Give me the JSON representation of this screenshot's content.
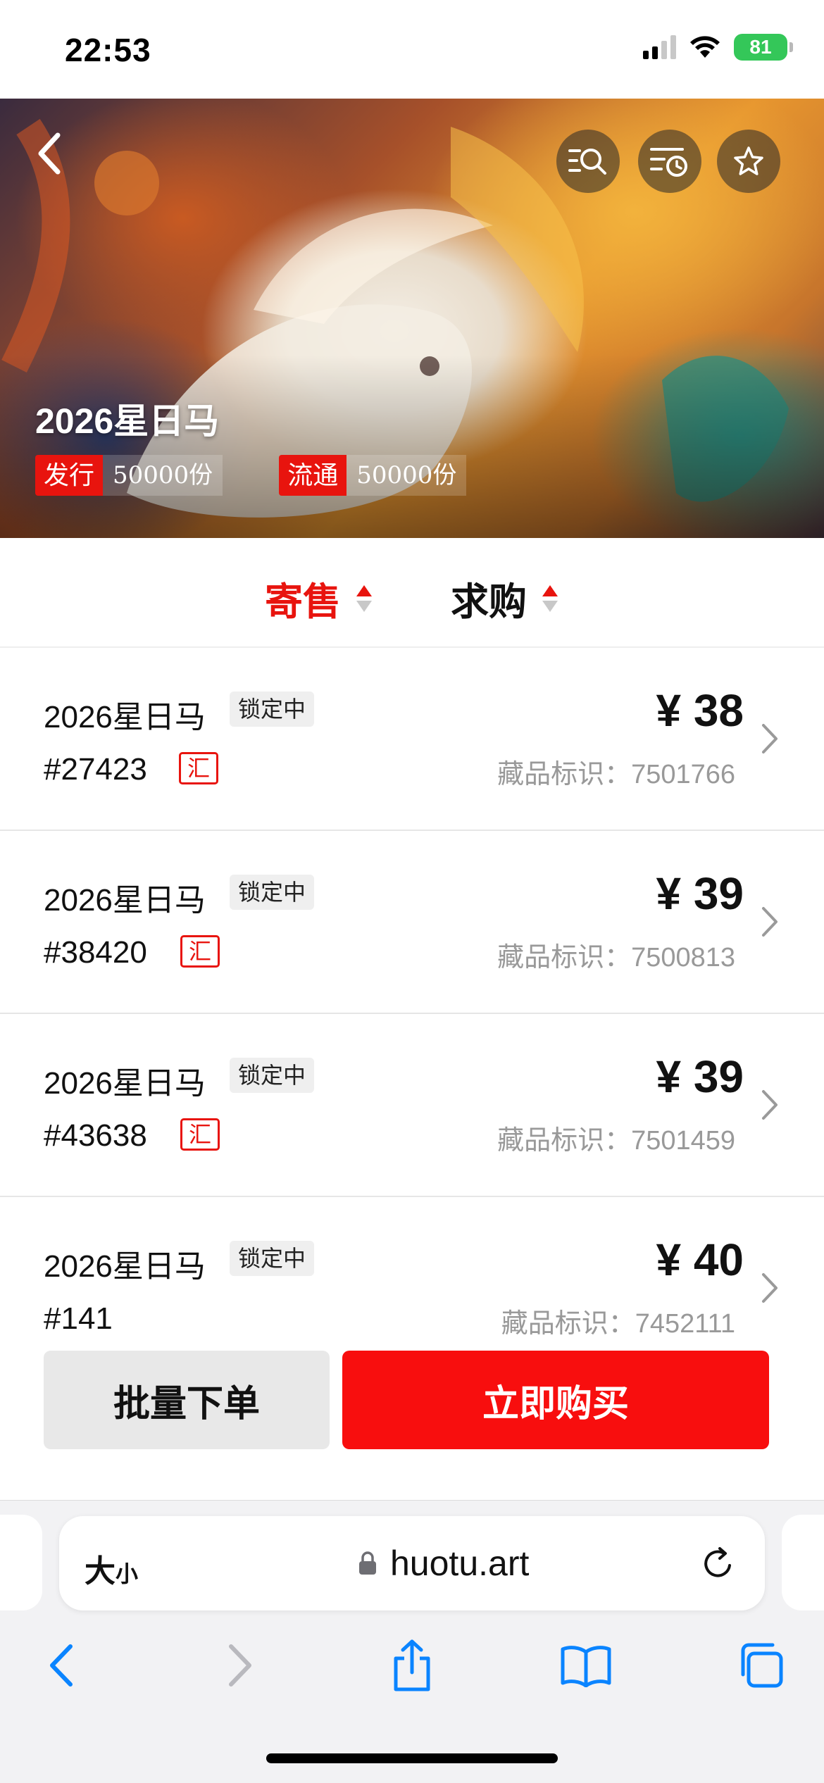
{
  "status_bar": {
    "time": "22:53",
    "battery": "81"
  },
  "hero": {
    "title": "2026星日马",
    "issue_label": "发行",
    "issue_value": "50000份",
    "circulation_label": "流通",
    "circulation_value": "50000份",
    "icons": [
      "back-chevron-icon",
      "search-list-icon",
      "history-list-icon",
      "star-icon"
    ]
  },
  "tabs": [
    {
      "label": "寄售",
      "active": true,
      "color": "#e8140e"
    },
    {
      "label": "求购",
      "active": false,
      "color": "#111111"
    }
  ],
  "listings": [
    {
      "name": "2026星日马",
      "status": "锁定中",
      "number": "#27423",
      "badge": "汇",
      "price": "¥ 38",
      "id_text": "藏品标识：7501766"
    },
    {
      "name": "2026星日马",
      "status": "锁定中",
      "number": "#38420",
      "badge": "汇",
      "price": "¥ 39",
      "id_text": "藏品标识：7500813"
    },
    {
      "name": "2026星日马",
      "status": "锁定中",
      "number": "#43638",
      "badge": "汇",
      "price": "¥ 39",
      "id_text": "藏品标识：7501459"
    },
    {
      "name": "2026星日马",
      "status": "锁定中",
      "number": "#141",
      "badge": "",
      "price": "¥ 40",
      "id_text": "藏品标识：7452111"
    }
  ],
  "actions": {
    "bulk_label": "批量下单",
    "buy_label": "立即购买"
  },
  "browser": {
    "aa_big": "大",
    "aa_small": "小",
    "url": "huotu.art",
    "toolbar_icons": [
      "back-icon",
      "forward-icon",
      "share-icon",
      "bookmarks-icon",
      "tabs-icon"
    ]
  },
  "colors": {
    "accent_red": "#f80e0e",
    "ios_blue": "#0a84ff",
    "battery_green": "#34c759"
  }
}
